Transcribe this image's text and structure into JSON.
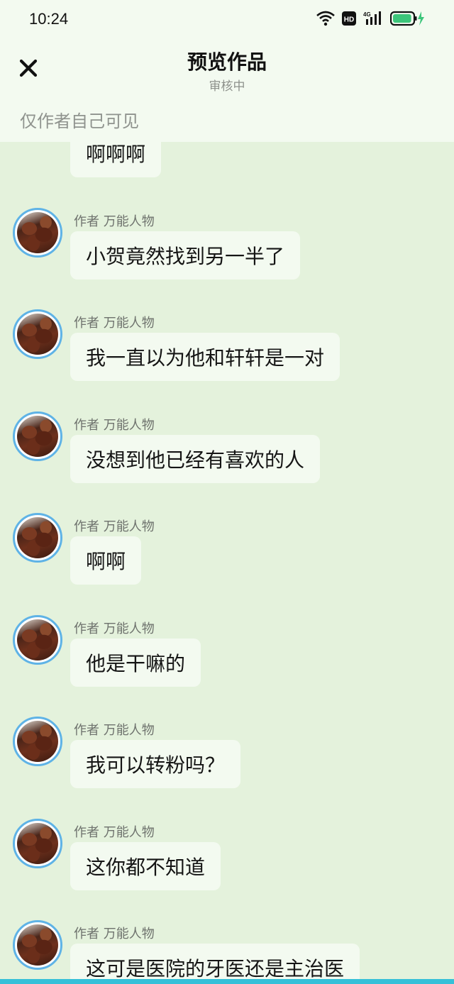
{
  "status": {
    "time": "10:24",
    "hd_label": "HD",
    "network_label": "4G",
    "battery_level": 0.95,
    "accent": "#3cc57a"
  },
  "header": {
    "title": "预览作品",
    "subtitle": "审核中",
    "visibility_note": "仅作者自己可见"
  },
  "messages": [
    {
      "author": "",
      "text": "啊啊啊"
    },
    {
      "author": "作者 万能人物",
      "text": "小贺竟然找到另一半了"
    },
    {
      "author": "作者 万能人物",
      "text": "我一直以为他和轩轩是一对"
    },
    {
      "author": "作者 万能人物",
      "text": "没想到他已经有喜欢的人"
    },
    {
      "author": "作者 万能人物",
      "text": "啊啊"
    },
    {
      "author": "作者 万能人物",
      "text": "他是干嘛的"
    },
    {
      "author": "作者 万能人物",
      "text": "我可以转粉吗？"
    },
    {
      "author": "作者 万能人物",
      "text": "这你都不知道"
    },
    {
      "author": "作者 万能人物",
      "text": "这可是医院的牙医还是主治医"
    }
  ]
}
